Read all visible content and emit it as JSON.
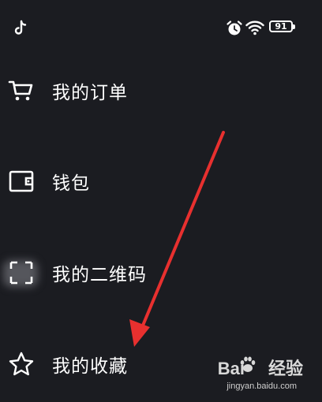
{
  "status_bar": {
    "app_icon": "tiktok-icon",
    "alarm_icon": "alarm-clock-icon",
    "wifi_icon": "wifi-icon",
    "battery_level": "91"
  },
  "menu": {
    "items": [
      {
        "label": "我的订单",
        "icon": "shopping-cart-icon"
      },
      {
        "label": "钱包",
        "icon": "wallet-icon"
      },
      {
        "label": "我的二维码",
        "icon": "qr-code-icon"
      },
      {
        "label": "我的收藏",
        "icon": "star-icon"
      }
    ]
  },
  "annotation": {
    "arrow_color": "#e8302f"
  },
  "watermark": {
    "brand_left": "Bai",
    "brand_right": "经验",
    "url": "jingyan.baidu.com"
  }
}
